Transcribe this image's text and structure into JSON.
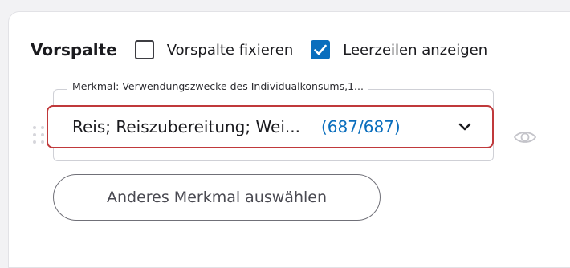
{
  "section": {
    "title": "Vorspalte",
    "options": [
      {
        "label": "Vorspalte fixieren",
        "checked": false
      },
      {
        "label": "Leerzeilen anzeigen",
        "checked": true
      }
    ]
  },
  "feature": {
    "legend": "Merkmal: Verwendungszwecke des Individualkonsums,1...",
    "selected_value": "Reis; Reiszubereitung; Wei...",
    "count": "(687/687)",
    "dropdown_icon": "chevron-down-icon",
    "visibility_icon": "eye-icon",
    "drag_icon": "drag-handle-icon"
  },
  "actions": {
    "choose_other_label": "Anderes Merkmal auswählen"
  },
  "colors": {
    "accent": "#0a6ebd",
    "focus_border": "#c0393b"
  }
}
